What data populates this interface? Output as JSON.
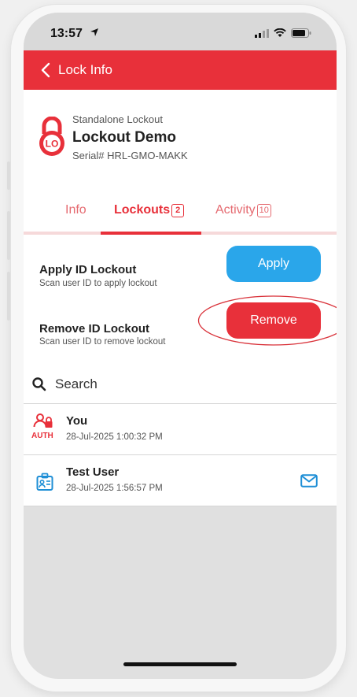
{
  "status_bar": {
    "time": "13:57"
  },
  "header": {
    "title": "Lock Info"
  },
  "lock": {
    "type": "Standalone Lockout",
    "name": "Lockout Demo",
    "serial": "Serial# HRL-GMO-MAKK",
    "icon_text": "LO"
  },
  "tabs": [
    {
      "label": "Info"
    },
    {
      "label": "Lockouts",
      "count": "2"
    },
    {
      "label": "Activity",
      "count": "10"
    }
  ],
  "actions": {
    "apply": {
      "title": "Apply ID Lockout",
      "subtitle": "Scan user ID to apply lockout",
      "button": "Apply"
    },
    "remove": {
      "title": "Remove ID Lockout",
      "subtitle": "Scan user ID to remove lockout",
      "button": "Remove"
    }
  },
  "search": {
    "label": "Search"
  },
  "lockouts": [
    {
      "name": "You",
      "date": "28-Jul-2025 1:00:32 PM",
      "badge": "AUTH"
    },
    {
      "name": "Test User",
      "date": "28-Jul-2025 1:56:57 PM"
    }
  ],
  "colors": {
    "brand_red": "#e8303a",
    "apply_blue": "#2aa6ea"
  }
}
